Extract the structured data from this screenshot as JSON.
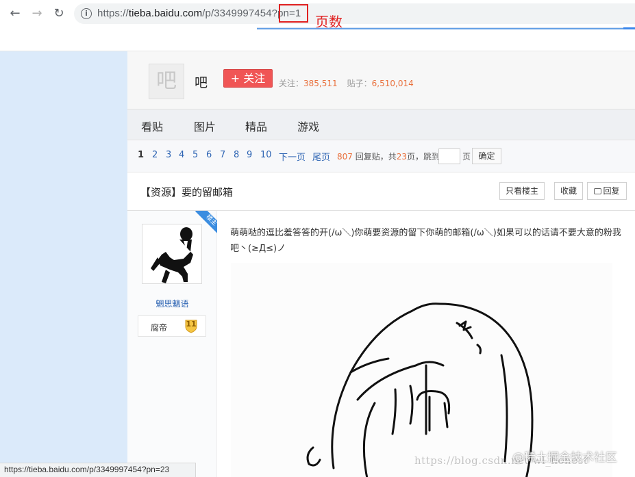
{
  "browser": {
    "url_prefix": "https://",
    "url_host": "tieba.baidu.com",
    "url_path": "/p/3349997454?pn=1",
    "highlighted_fragment": "pn=1",
    "annotation": "页数",
    "status_url": "https://tieba.baidu.com/p/3349997454?pn=23"
  },
  "forum": {
    "avatar_glyph": "吧",
    "name": "吧",
    "follow_label": "+ 关注",
    "followers_label": "关注：",
    "followers": "385,511",
    "posts_label": "贴子：",
    "posts": "6,510,014"
  },
  "tabs": [
    "看贴",
    "图片",
    "精品",
    "游戏"
  ],
  "pager": {
    "pages": [
      "1",
      "2",
      "3",
      "4",
      "5",
      "6",
      "7",
      "8",
      "9",
      "10"
    ],
    "current": "1",
    "next_label": "下一页",
    "last_label": "尾页",
    "reply_count": "807",
    "reply_label": "回复贴，共",
    "total_pages": "23",
    "page_suffix": "页，跳到",
    "page_unit": "页",
    "confirm_label": "确定"
  },
  "thread": {
    "title": "【资源】要的留邮箱",
    "only_op_label": "只看楼主",
    "favorite_label": "收藏",
    "reply_label": "回复",
    "reply_icon": "comment-icon"
  },
  "post": {
    "badge": "楼主",
    "author": "魍思魑语",
    "level_name": "腐帝",
    "level": "11",
    "content": "萌萌哒的逗比羞答答的开(/ω＼)你萌要资源的留下你萌的邮箱(/ω＼)如果可以的话请不要大意的粉我吧丶(≥Д≤)ノ"
  },
  "overlay": {
    "watermark": "https://blog.csdn.net/wl_honest",
    "watermark2": "@稀土掘金技术社区"
  },
  "colors": {
    "accent": "#2d64b3",
    "follow": "#f05555",
    "stat_number": "#e9703c",
    "sidebar": "#dbeafa",
    "annotation": "#e02020"
  }
}
